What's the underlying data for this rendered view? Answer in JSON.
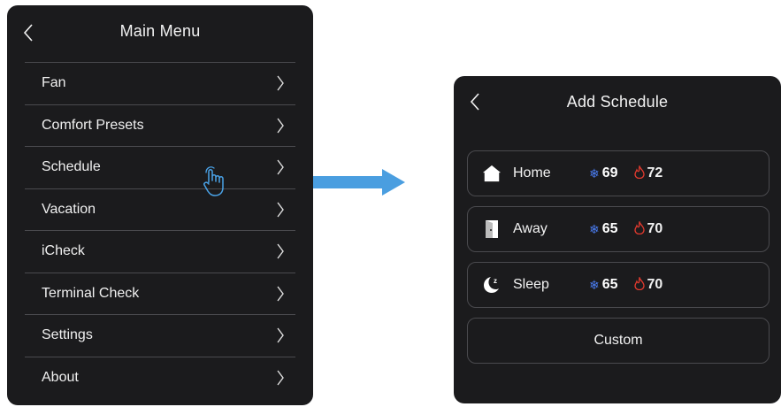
{
  "main_menu": {
    "title": "Main Menu",
    "items": [
      {
        "label": "Fan"
      },
      {
        "label": "Comfort Presets"
      },
      {
        "label": "Schedule"
      },
      {
        "label": "Vacation"
      },
      {
        "label": "iCheck"
      },
      {
        "label": "Terminal Check"
      },
      {
        "label": "Settings"
      },
      {
        "label": "About"
      }
    ]
  },
  "add_schedule": {
    "title": "Add Schedule",
    "presets": [
      {
        "label": "Home",
        "cool": "69",
        "heat": "72",
        "icon": "home-icon"
      },
      {
        "label": "Away",
        "cool": "65",
        "heat": "70",
        "icon": "door-icon"
      },
      {
        "label": "Sleep",
        "cool": "65",
        "heat": "70",
        "icon": "moon-icon"
      }
    ],
    "custom_label": "Custom"
  },
  "colors": {
    "panel_bg": "#1b1b1d",
    "cool": "#4a7cf0",
    "heat": "#e23a2e",
    "arrow": "#4a9ee0"
  }
}
